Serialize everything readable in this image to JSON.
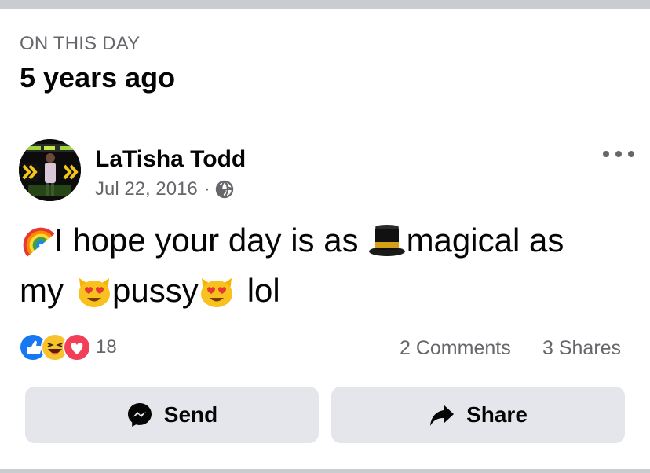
{
  "memory": {
    "label": "ON THIS DAY",
    "title": "5 years ago"
  },
  "post": {
    "author": "LaTisha Todd",
    "date": "Jul 22, 2016",
    "separator": "·",
    "privacy_icon": "globe-icon",
    "text_segments": {
      "s1": "I hope your day is as",
      "s2": "magical as",
      "s3": "my",
      "s4": "pussy",
      "s5": "lol"
    },
    "emojis": [
      "rainbow",
      "top-hat",
      "heart-eyes-cat",
      "heart-eyes-cat"
    ]
  },
  "engagement": {
    "reaction_icons": [
      "like-reaction-icon",
      "haha-reaction-icon",
      "love-reaction-icon"
    ],
    "reaction_count": "18",
    "comments": "2 Comments",
    "shares": "3 Shares"
  },
  "actions": {
    "send_label": "Send",
    "share_label": "Share"
  },
  "colors": {
    "text_primary": "#050505",
    "text_secondary": "#65676b",
    "button_bg": "#e4e6eb",
    "like_blue": "#1877f2",
    "love_red": "#f33e58"
  }
}
